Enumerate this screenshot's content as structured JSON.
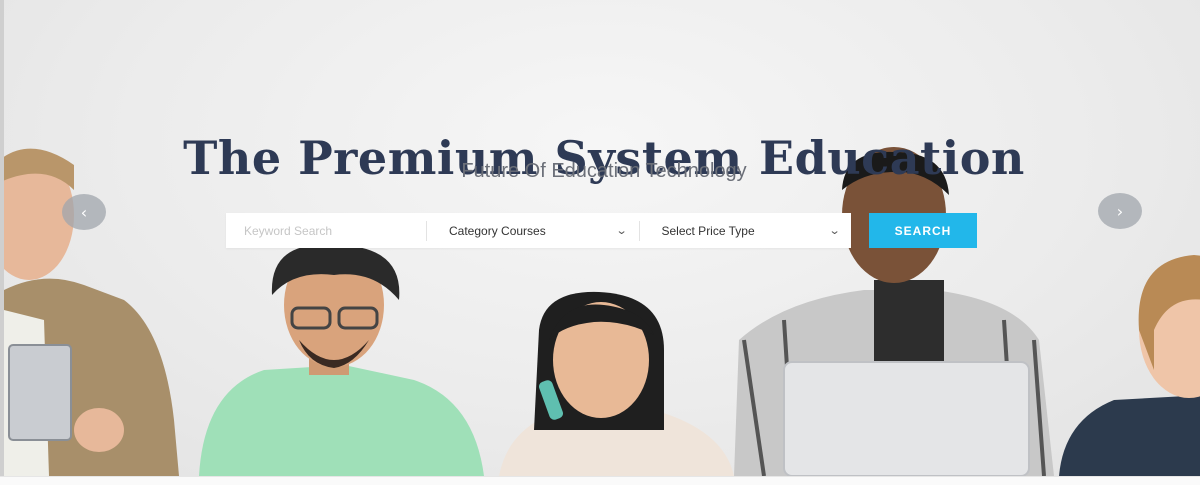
{
  "hero": {
    "title": "The Premium System Education",
    "subtitle": "Future Of Education Technology"
  },
  "search": {
    "keyword_placeholder": "Keyword Search",
    "category_label": "Category Courses",
    "price_label": "Select Price Type",
    "button_label": "SEARCH"
  },
  "slider": {
    "prev_icon": "‹",
    "next_icon": "›"
  },
  "colors": {
    "title": "#2e3a55",
    "accent": "#22b7ea",
    "subtitle": "#6b6f78"
  }
}
